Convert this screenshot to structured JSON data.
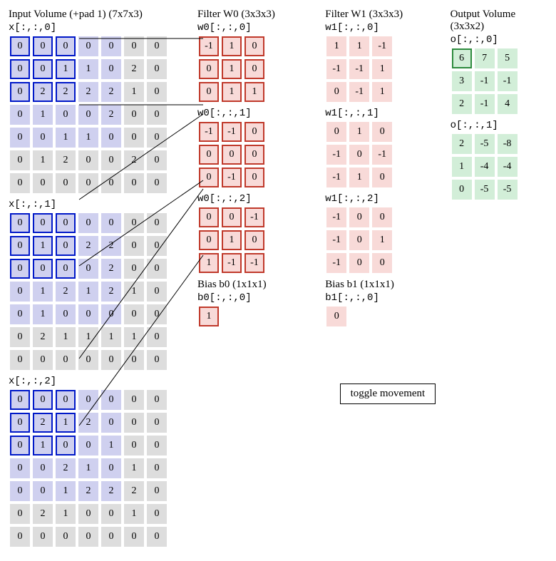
{
  "input": {
    "title": "Input Volume (+pad 1) (7x7x3)"
  },
  "w0": {
    "title": "Filter W0 (3x3x3)"
  },
  "w1": {
    "title": "Filter W1 (3x3x3)"
  },
  "out": {
    "title": "Output Volume (3x3x2)"
  },
  "bias0": {
    "title": "Bias b0 (1x1x1)",
    "slice": "b0[:,:,0]",
    "value": 1
  },
  "bias1": {
    "title": "Bias b1 (1x1x1)",
    "slice": "b1[:,:,0]",
    "value": 0
  },
  "toggle": "toggle movement",
  "input_slices": [
    {
      "label": "x[:,:,0]",
      "rows": [
        [
          0,
          0,
          0,
          0,
          0,
          0,
          0
        ],
        [
          0,
          0,
          1,
          1,
          0,
          2,
          0
        ],
        [
          0,
          2,
          2,
          2,
          2,
          1,
          0
        ],
        [
          0,
          1,
          0,
          0,
          2,
          0,
          0
        ],
        [
          0,
          0,
          1,
          1,
          0,
          0,
          0
        ],
        [
          0,
          1,
          2,
          0,
          0,
          2,
          0
        ],
        [
          0,
          0,
          0,
          0,
          0,
          0,
          0
        ]
      ]
    },
    {
      "label": "x[:,:,1]",
      "rows": [
        [
          0,
          0,
          0,
          0,
          0,
          0,
          0
        ],
        [
          0,
          1,
          0,
          2,
          2,
          0,
          0
        ],
        [
          0,
          0,
          0,
          0,
          2,
          0,
          0
        ],
        [
          0,
          1,
          2,
          1,
          2,
          1,
          0
        ],
        [
          0,
          1,
          0,
          0,
          0,
          0,
          0
        ],
        [
          0,
          2,
          1,
          1,
          1,
          1,
          0
        ],
        [
          0,
          0,
          0,
          0,
          0,
          0,
          0
        ]
      ]
    },
    {
      "label": "x[:,:,2]",
      "rows": [
        [
          0,
          0,
          0,
          0,
          0,
          0,
          0
        ],
        [
          0,
          2,
          1,
          2,
          0,
          0,
          0
        ],
        [
          0,
          1,
          0,
          0,
          1,
          0,
          0
        ],
        [
          0,
          0,
          2,
          1,
          0,
          1,
          0
        ],
        [
          0,
          0,
          1,
          2,
          2,
          2,
          0
        ],
        [
          0,
          2,
          1,
          0,
          0,
          1,
          0
        ],
        [
          0,
          0,
          0,
          0,
          0,
          0,
          0
        ]
      ]
    }
  ],
  "w0_slices": [
    {
      "label": "w0[:,:,0]",
      "rows": [
        [
          -1,
          1,
          0
        ],
        [
          0,
          1,
          0
        ],
        [
          0,
          1,
          1
        ]
      ]
    },
    {
      "label": "w0[:,:,1]",
      "rows": [
        [
          -1,
          -1,
          0
        ],
        [
          0,
          0,
          0
        ],
        [
          0,
          -1,
          0
        ]
      ]
    },
    {
      "label": "w0[:,:,2]",
      "rows": [
        [
          0,
          0,
          -1
        ],
        [
          0,
          1,
          0
        ],
        [
          1,
          -1,
          -1
        ]
      ]
    }
  ],
  "w1_slices": [
    {
      "label": "w1[:,:,0]",
      "rows": [
        [
          1,
          1,
          -1
        ],
        [
          -1,
          -1,
          1
        ],
        [
          0,
          -1,
          1
        ]
      ]
    },
    {
      "label": "w1[:,:,1]",
      "rows": [
        [
          0,
          1,
          0
        ],
        [
          -1,
          0,
          -1
        ],
        [
          -1,
          1,
          0
        ]
      ]
    },
    {
      "label": "w1[:,:,2]",
      "rows": [
        [
          -1,
          0,
          0
        ],
        [
          -1,
          0,
          1
        ],
        [
          -1,
          0,
          0
        ]
      ]
    }
  ],
  "out_slices": [
    {
      "label": "o[:,:,0]",
      "rows": [
        [
          6,
          7,
          5
        ],
        [
          3,
          -1,
          -1
        ],
        [
          2,
          -1,
          4
        ]
      ]
    },
    {
      "label": "o[:,:,1]",
      "rows": [
        [
          2,
          -5,
          -8
        ],
        [
          1,
          -4,
          -4
        ],
        [
          0,
          -5,
          -5
        ]
      ]
    }
  ],
  "highlight": {
    "input_window": {
      "row0": 0,
      "col0": 0,
      "size": 3
    },
    "output_cell": {
      "slice": 0,
      "row": 0,
      "col": 0
    }
  }
}
